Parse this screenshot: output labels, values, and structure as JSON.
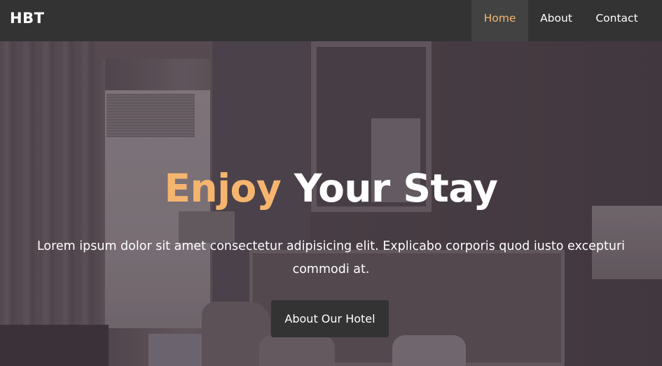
{
  "navbar": {
    "brand": "HBT",
    "items": [
      {
        "label": "Home",
        "active": true
      },
      {
        "label": "About",
        "active": false
      },
      {
        "label": "Contact",
        "active": false
      }
    ]
  },
  "hero": {
    "title_accent": "Enjoy",
    "title_rest": "Your Stay",
    "text": "Lorem ipsum dolor sit amet consectetur adipisicing elit. Explicabo corporis quod iusto excepturi commodi at.",
    "button_label": "About Our Hotel"
  },
  "colors": {
    "accent": "#f5b56f",
    "navbar_bg": "#333333",
    "active_nav_bg": "#424242",
    "button_bg": "#333333"
  }
}
